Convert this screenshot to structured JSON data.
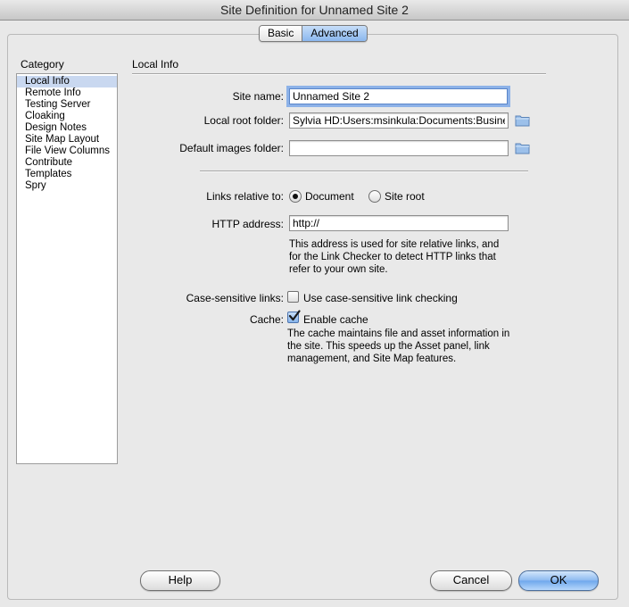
{
  "window": {
    "title": "Site Definition for Unnamed Site 2"
  },
  "tabs": [
    {
      "label": "Basic",
      "active": false
    },
    {
      "label": "Advanced",
      "active": true
    }
  ],
  "sidebar": {
    "heading": "Category",
    "items": [
      "Local Info",
      "Remote Info",
      "Testing Server",
      "Cloaking",
      "Design Notes",
      "Site Map Layout",
      "File View Columns",
      "Contribute",
      "Templates",
      "Spry"
    ],
    "selected": "Local Info"
  },
  "section": {
    "title": "Local Info"
  },
  "form": {
    "site_name": {
      "label": "Site name:",
      "value": "Unnamed Site 2"
    },
    "local_root": {
      "label": "Local root folder:",
      "value": "Sylvia HD:Users:msinkula:Documents:Business"
    },
    "default_images": {
      "label": "Default images folder:",
      "value": ""
    },
    "links_relative": {
      "label": "Links relative to:",
      "options": [
        "Document",
        "Site root"
      ],
      "selected": "Document"
    },
    "http_address": {
      "label": "HTTP address:",
      "value": "http://",
      "help": [
        "This address is used for site relative links, and",
        "for the Link Checker to detect HTTP links that",
        "refer to your own site."
      ]
    },
    "case_sensitive": {
      "label": "Case-sensitive links:",
      "option": "Use case-sensitive link checking",
      "checked": false
    },
    "cache": {
      "label": "Cache:",
      "option": "Enable cache",
      "checked": true,
      "help": [
        "The cache maintains file and asset information in",
        "the site.  This speeds up the Asset panel, link",
        "management, and Site Map features."
      ]
    }
  },
  "buttons": {
    "help": "Help",
    "cancel": "Cancel",
    "ok": "OK"
  },
  "colors": {
    "selection": "#c9d8f0",
    "accent": "#8bb9f0",
    "focus_ring": "#8db2e8",
    "folder": "#8fb6e3"
  }
}
